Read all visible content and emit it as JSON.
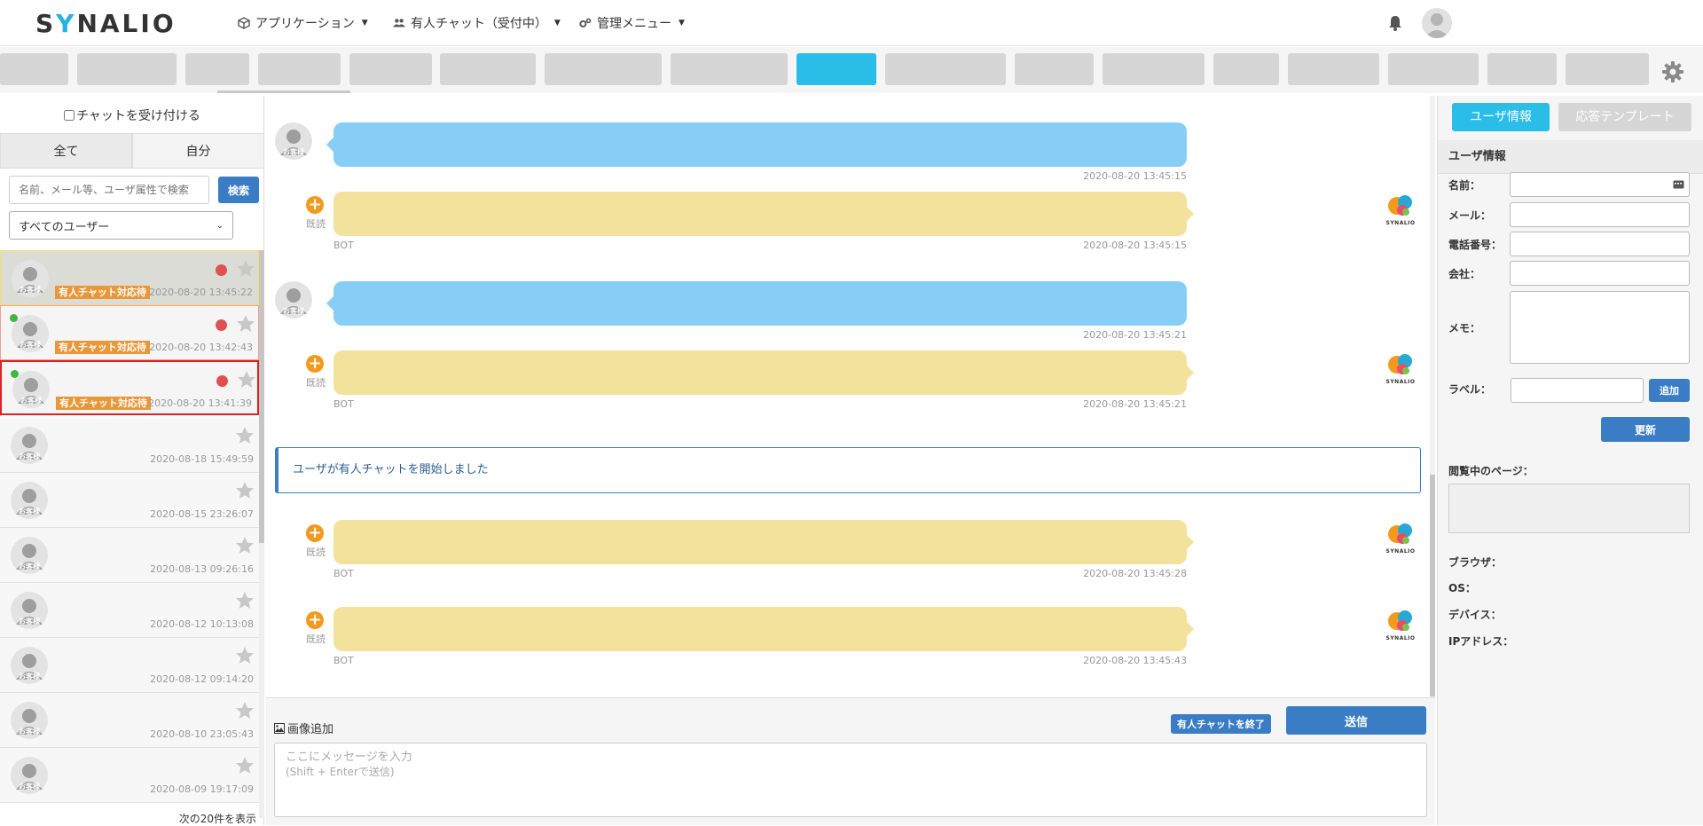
{
  "header": {
    "logo": "SYNALIO",
    "nav": [
      {
        "label": "アプリケーション",
        "icon": "cube-icon"
      },
      {
        "label": "有人チャット（受付中）",
        "icon": "users-icon"
      },
      {
        "label": "管理メニュー",
        "icon": "cogs-icon"
      }
    ]
  },
  "left": {
    "accept_label": "チャットを受け付ける",
    "tabs": [
      "全て",
      "自分"
    ],
    "search_placeholder": "名前、メール等、ユーザ属性で検索",
    "search_button": "検索",
    "user_filter": "すべてのユーザー",
    "avatar_label": "お客様",
    "chat_badge": "有人チャット対応待",
    "items": [
      {
        "time": "2020-08-20 13:45:22",
        "badge": true,
        "online": false,
        "unread": true
      },
      {
        "time": "2020-08-20 13:42:43",
        "badge": true,
        "online": true,
        "unread": true
      },
      {
        "time": "2020-08-20 13:41:39",
        "badge": true,
        "online": true,
        "unread": true
      },
      {
        "time": "2020-08-18 15:49:59",
        "badge": false,
        "online": false,
        "unread": false
      },
      {
        "time": "2020-08-15 23:26:07",
        "badge": false,
        "online": false,
        "unread": false
      },
      {
        "time": "2020-08-13 09:26:16",
        "badge": false,
        "online": false,
        "unread": false
      },
      {
        "time": "2020-08-12 10:13:08",
        "badge": false,
        "online": false,
        "unread": false
      },
      {
        "time": "2020-08-12 09:14:20",
        "badge": false,
        "online": false,
        "unread": false
      },
      {
        "time": "2020-08-10 23:05:43",
        "badge": false,
        "online": false,
        "unread": false
      },
      {
        "time": "2020-08-09 19:17:09",
        "badge": false,
        "online": false,
        "unread": false
      }
    ],
    "more_label": "次の20件を表示"
  },
  "chat": {
    "read_label": "既読",
    "bot_name": "BOT",
    "bot_logo_text": "SYNALIO",
    "messages": [
      {
        "time": "2020-08-20 13:45:15"
      },
      {
        "time": "2020-08-20 13:45:15"
      },
      {
        "time": "2020-08-20 13:45:21"
      },
      {
        "time": "2020-08-20 13:45:21"
      },
      {
        "time": "2020-08-20 13:45:28"
      },
      {
        "time": "2020-08-20 13:45:43"
      }
    ],
    "notice": "ユーザが有人チャットを開始しました"
  },
  "composer": {
    "image_add": "画像追加",
    "end_button": "有人チャットを終了",
    "send_button": "送信",
    "placeholder_line1": "ここにメッセージを入力",
    "placeholder_line2": "(Shift + Enterで送信)"
  },
  "right": {
    "tab_user": "ユーザ情報",
    "tab_template": "応答テンプレート",
    "section_title": "ユーザ情報",
    "fields": {
      "name": "名前：",
      "email": "メール：",
      "phone": "電話番号：",
      "company": "会社：",
      "memo": "メモ：",
      "label": "ラベル："
    },
    "add_button": "追加",
    "update_button": "更新",
    "viewing_page": "閲覧中のページ：",
    "browser": "ブラウザ：",
    "os": "OS：",
    "device": "デバイス：",
    "ip": "IPアドレス："
  },
  "colors": {
    "accent": "#29bde8",
    "primary_button": "#3a7dc4",
    "user_bubble": "#87cef7",
    "bot_bubble": "#f2e29b",
    "badge": "#e8983a"
  }
}
